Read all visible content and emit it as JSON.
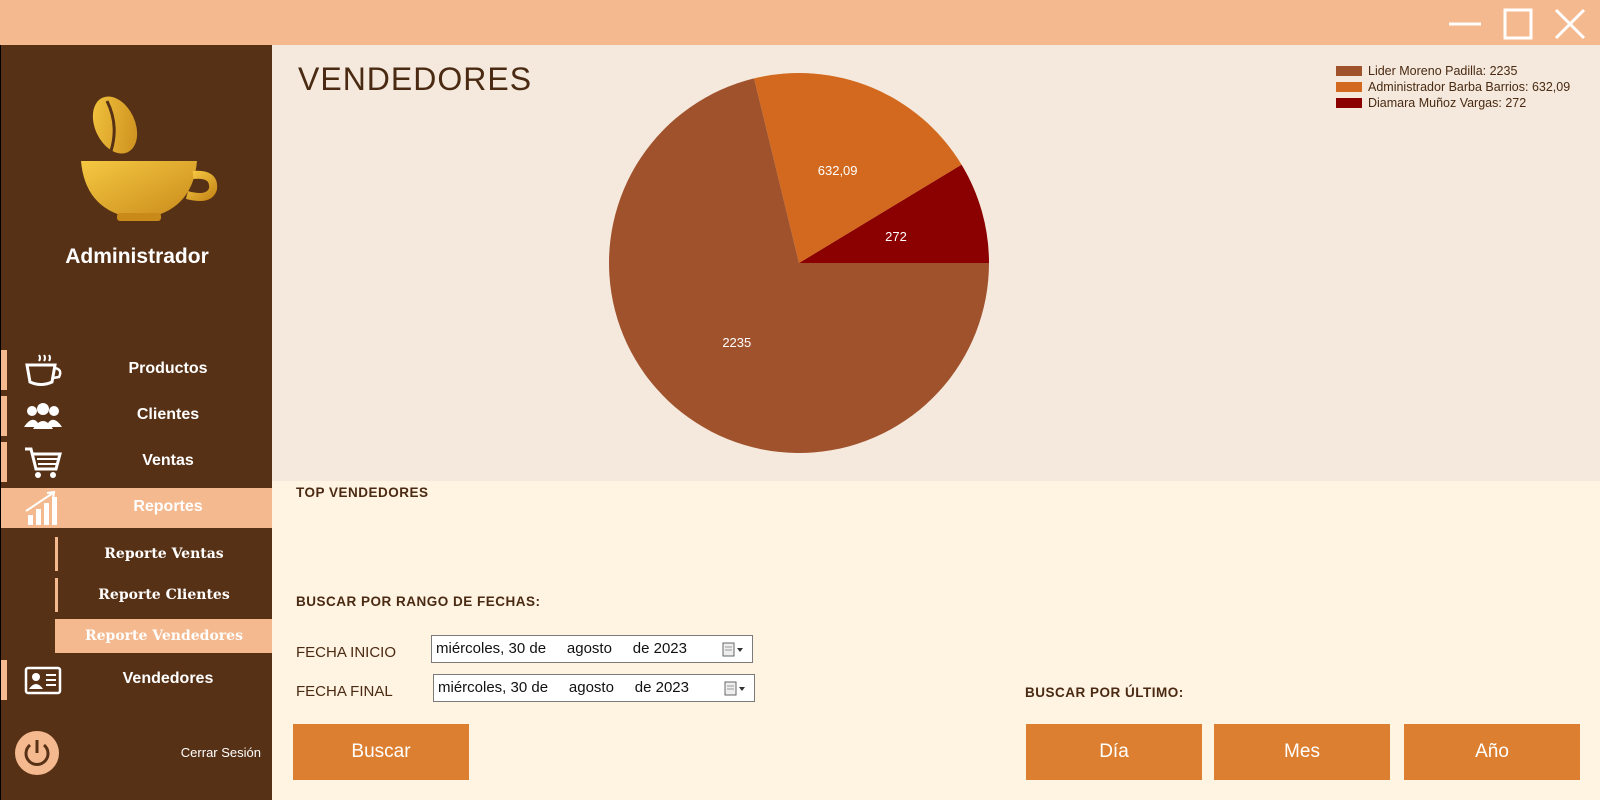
{
  "window": {
    "controls": [
      "minimize-icon",
      "maximize-icon",
      "close-icon"
    ]
  },
  "sidebar": {
    "role": "Administrador",
    "items": [
      {
        "label": "Productos",
        "icon": "coffee-cup-icon"
      },
      {
        "label": "Clientes",
        "icon": "users-icon"
      },
      {
        "label": "Ventas",
        "icon": "shopping-cart-icon"
      },
      {
        "label": "Reportes",
        "icon": "chart-icon",
        "active": true
      },
      {
        "label": "Vendedores",
        "icon": "id-card-icon"
      }
    ],
    "sub_items": [
      {
        "label": "Reporte Ventas"
      },
      {
        "label": "Reporte Clientes"
      },
      {
        "label": "Reporte Vendedores",
        "active": true
      }
    ],
    "logout_label": "Cerrar Sesión"
  },
  "main": {
    "title": "VENDEDORES",
    "top_label": "TOP VENDEDORES",
    "range_label": "BUSCAR POR RANGO DE FECHAS:",
    "start_label": "FECHA INICIO",
    "start_value": "miércoles, 30 de     agosto     de 2023",
    "end_label": "FECHA FINAL",
    "end_value": "miércoles, 30 de     agosto     de 2023",
    "search_button": "Buscar",
    "last_label": "BUSCAR POR ÚLTIMO:",
    "day_button": "Día",
    "month_button": "Mes",
    "year_button": "Año"
  },
  "chart_data": {
    "type": "pie",
    "title": "",
    "slices": [
      {
        "label": "Lider Moreno Padilla: 2235",
        "data_label": "2235",
        "value": 2235,
        "color": "#a0522d"
      },
      {
        "label": "Administrador Barba Barrios: 632,09",
        "data_label": "632,09",
        "value": 632.09,
        "color": "#d2691e"
      },
      {
        "label": "Diamara Muñoz Vargas: 272",
        "data_label": "272",
        "value": 272,
        "color": "#8b0000"
      }
    ],
    "legend_position": "top-right"
  },
  "colors": {
    "accent": "#f4b98f",
    "sidebar": "#573116",
    "button": "#dc7f30",
    "chart_bg": "#f4e9dc",
    "panel_bg": "#fff3e2"
  }
}
